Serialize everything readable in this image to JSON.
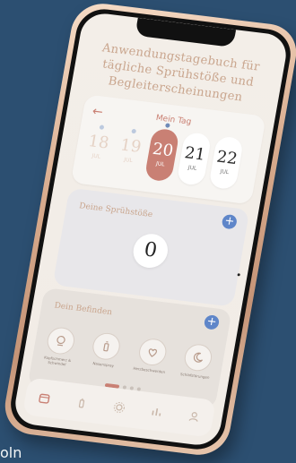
{
  "app": {
    "headline": "Anwendungstagebuch für tägliche Sprühstöße und Begleiterscheinungen"
  },
  "day_card": {
    "title": "Mein Tag",
    "dates": [
      {
        "day": "18",
        "month": "JUL",
        "state": "faint",
        "has_dot": true
      },
      {
        "day": "19",
        "month": "JUL",
        "state": "faint",
        "has_dot": true
      },
      {
        "day": "20",
        "month": "JUL",
        "state": "selected",
        "has_dot": true
      },
      {
        "day": "21",
        "month": "JUL",
        "state": "light",
        "has_dot": false
      },
      {
        "day": "22",
        "month": "JUL",
        "state": "light",
        "has_dot": false
      }
    ]
  },
  "sprays_card": {
    "title": "Deine Sprühstöße",
    "count": "0"
  },
  "feel_card": {
    "title": "Dein Befinden",
    "symptoms": [
      {
        "label": "Kopfschmerz & Schwindel",
        "icon": "head-icon"
      },
      {
        "label": "Nasenspray",
        "icon": "spray-icon"
      },
      {
        "label": "Herzbeschwerden",
        "icon": "heart-icon"
      },
      {
        "label": "Schlafstörungen",
        "icon": "moon-icon"
      }
    ],
    "pager": {
      "pages": 4,
      "active": 1
    }
  },
  "nav": {
    "items": [
      {
        "icon": "calendar-icon",
        "active": true
      },
      {
        "icon": "spray-icon",
        "active": false
      },
      {
        "icon": "gear-icon",
        "active": false
      },
      {
        "icon": "chart-icon",
        "active": false
      },
      {
        "icon": "profile-icon",
        "active": false
      }
    ]
  },
  "footer": {
    "left_text": "oln"
  },
  "colors": {
    "background": "#2c4f71",
    "accent": "#c98074",
    "accent_text": "#c9a58d",
    "plus_button": "#5f86c9"
  }
}
